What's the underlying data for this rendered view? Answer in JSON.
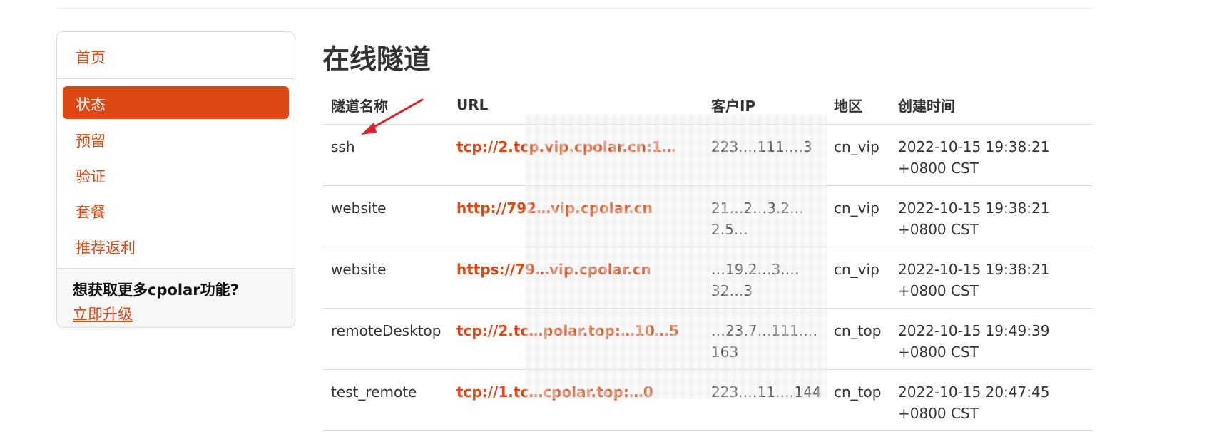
{
  "sidebar": {
    "home_label": "首页",
    "items": [
      {
        "label": "状态",
        "active": true
      },
      {
        "label": "预留",
        "active": false
      },
      {
        "label": "验证",
        "active": false
      },
      {
        "label": "套餐",
        "active": false
      },
      {
        "label": "推荐返利",
        "active": false
      }
    ],
    "promo": {
      "title": "想获取更多cpolar功能?",
      "link": "立即升级"
    }
  },
  "main": {
    "title": "在线隧道",
    "table": {
      "headers": [
        "隧道名称",
        "URL",
        "客户IP",
        "地区",
        "创建时间"
      ],
      "rows": [
        {
          "name": "ssh",
          "url": "tcp://2.tcp.vip.cpolar.cn:1…",
          "ip": "223.…111.…3",
          "region": "cn_vip",
          "created_date": "2022-10-15 19:38:21",
          "created_tz": "+0800 CST"
        },
        {
          "name": "website",
          "url": "http://792…vip.cpolar.cn",
          "ip": "21…2…3.2…2.5…",
          "region": "cn_vip",
          "created_date": "2022-10-15 19:38:21",
          "created_tz": "+0800 CST"
        },
        {
          "name": "website",
          "url": "https://79…vip.cpolar.cn",
          "ip": "…19.2…3.…32…3",
          "region": "cn_vip",
          "created_date": "2022-10-15 19:38:21",
          "created_tz": "+0800 CST"
        },
        {
          "name": "remoteDesktop",
          "url": "tcp://2.tc…polar.top:…10…5",
          "ip": "…23.7…111.…163",
          "region": "cn_top",
          "created_date": "2022-10-15 19:49:39",
          "created_tz": "+0800 CST"
        },
        {
          "name": "test_remote",
          "url": "tcp://1.tc…cpolar.top:…0",
          "ip": "223.…11.…144",
          "region": "cn_top",
          "created_date": "2022-10-15 20:47:45",
          "created_tz": "+0800 CST"
        }
      ]
    }
  },
  "colors": {
    "accent": "#dd4814",
    "annotation_arrow": "#e0202a"
  }
}
